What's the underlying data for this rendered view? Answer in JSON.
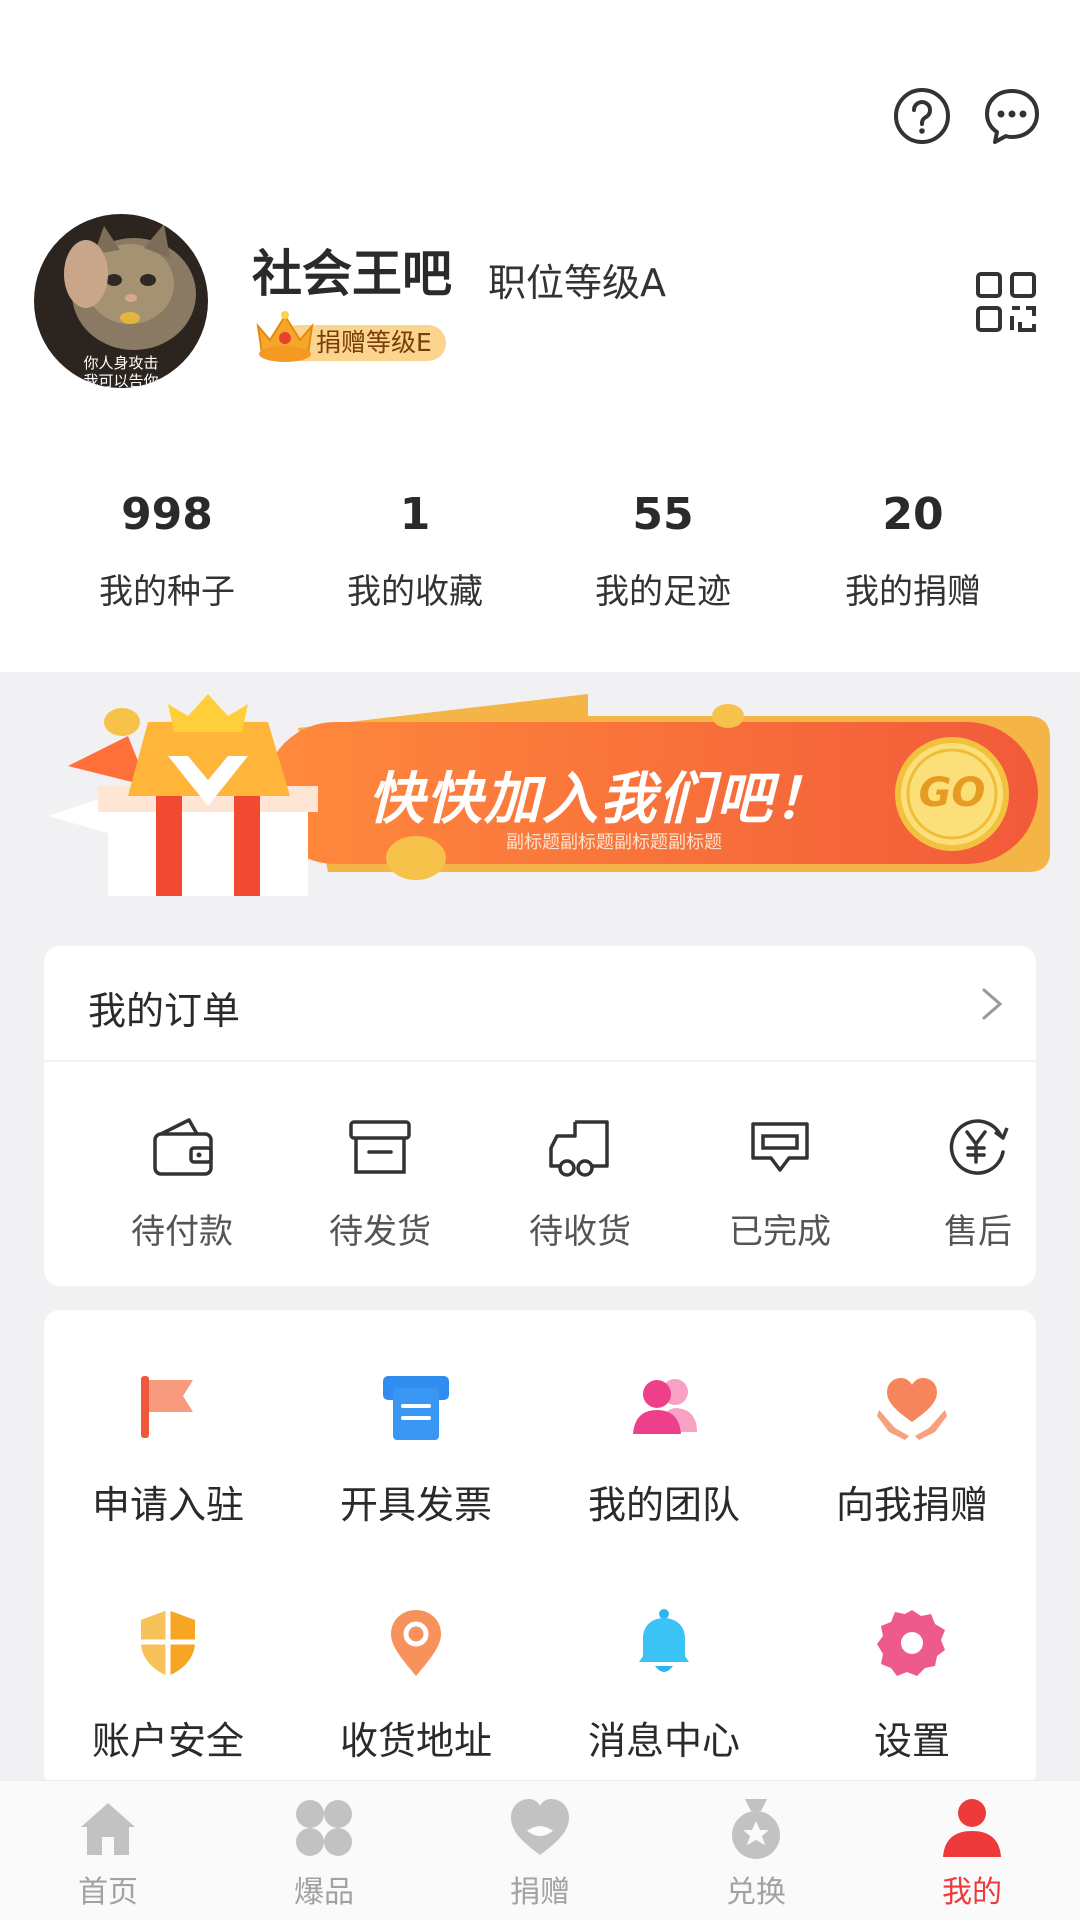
{
  "colors": {
    "accent": "#ee3a3a",
    "badge": "#fbd48f",
    "banner": "#f5623d",
    "gold": "#f7c84a"
  },
  "header": {
    "help_icon": "question-circle-icon",
    "message_icon": "chat-bubble-icon"
  },
  "profile": {
    "avatar_caption_1": "你人身攻击",
    "avatar_caption_2": "我可以告你",
    "name": "社会王吧",
    "position_level": "职位等级A",
    "donation_level": "捐赠等级E",
    "qr_icon": "qr-code-icon"
  },
  "stats": [
    {
      "value": "998",
      "label": "我的种子"
    },
    {
      "value": "1",
      "label": "我的收藏"
    },
    {
      "value": "55",
      "label": "我的足迹"
    },
    {
      "value": "20",
      "label": "我的捐赠"
    }
  ],
  "banner": {
    "title": "快快加入我们吧！",
    "subtitle": "副标题副标题副标题副标题",
    "go": "GO"
  },
  "orders": {
    "title": "我的订单",
    "items": [
      {
        "label": "待付款",
        "icon": "wallet-icon"
      },
      {
        "label": "待发货",
        "icon": "box-icon"
      },
      {
        "label": "待收货",
        "icon": "truck-icon"
      },
      {
        "label": "已完成",
        "icon": "done-icon"
      },
      {
        "label": "售后",
        "icon": "yen-refund-icon"
      }
    ]
  },
  "services": [
    {
      "label": "申请入驻",
      "icon": "flag-icon"
    },
    {
      "label": "开具发票",
      "icon": "invoice-icon"
    },
    {
      "label": "我的团队",
      "icon": "team-icon"
    },
    {
      "label": "向我捐赠",
      "icon": "heart-hands-icon"
    },
    {
      "label": "账户安全",
      "icon": "shield-icon"
    },
    {
      "label": "收货地址",
      "icon": "location-pin-icon"
    },
    {
      "label": "消息中心",
      "icon": "bell-icon"
    },
    {
      "label": "设置",
      "icon": "gear-icon"
    }
  ],
  "tabs": [
    {
      "label": "首页",
      "icon": "home-icon",
      "active": false
    },
    {
      "label": "爆品",
      "icon": "grid-icon",
      "active": false
    },
    {
      "label": "捐赠",
      "icon": "heart-icon",
      "active": false
    },
    {
      "label": "兑换",
      "icon": "exchange-bag-icon",
      "active": false
    },
    {
      "label": "我的",
      "icon": "person-icon",
      "active": true
    }
  ]
}
